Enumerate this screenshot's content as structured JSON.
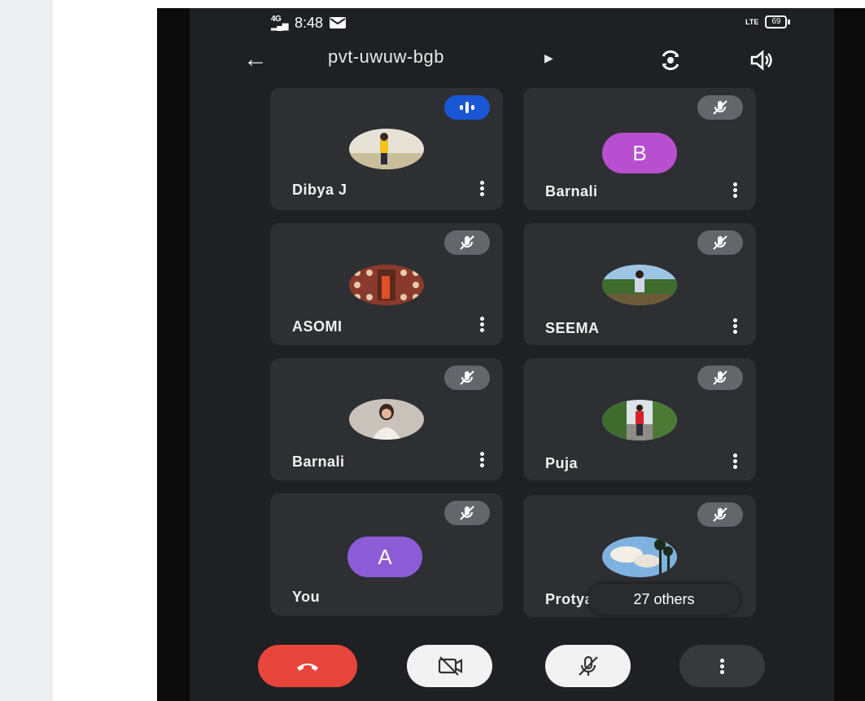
{
  "status_bar": {
    "network": "4G",
    "time": "8:48",
    "lte_label": "LTE",
    "battery": "69"
  },
  "header": {
    "meeting_code": "pvt-uwuw-bgb",
    "back_icon": "arrow-left-icon",
    "switch_camera_icon": "switch-camera-icon",
    "speaker_icon": "speaker-icon"
  },
  "participants": [
    {
      "name": "Dibya J",
      "avatar_type": "photo",
      "mic": "speaking"
    },
    {
      "name": "Barnali",
      "avatar_type": "letter",
      "letter": "B",
      "avatar_color": "#b84fd0",
      "mic": "muted"
    },
    {
      "name": "ASOMI",
      "avatar_type": "photo",
      "mic": "muted"
    },
    {
      "name": "SEEMA",
      "avatar_type": "photo",
      "mic": "muted"
    },
    {
      "name": "Barnali",
      "avatar_type": "photo",
      "mic": "muted"
    },
    {
      "name": "Puja",
      "avatar_type": "photo",
      "mic": "muted"
    },
    {
      "name": "You",
      "avatar_type": "letter",
      "letter": "A",
      "avatar_color": "#8b5cd6",
      "mic": "muted"
    },
    {
      "name": "Protya",
      "avatar_type": "photo",
      "mic": "muted"
    }
  ],
  "others_pill": {
    "label": "27 others"
  },
  "controls": {
    "end_call_color": "#e8453c",
    "end_call_icon": "hang-up-icon",
    "camera_icon": "camera-off-icon",
    "mic_icon": "mic-off-icon",
    "more_icon": "more-vert-icon"
  }
}
